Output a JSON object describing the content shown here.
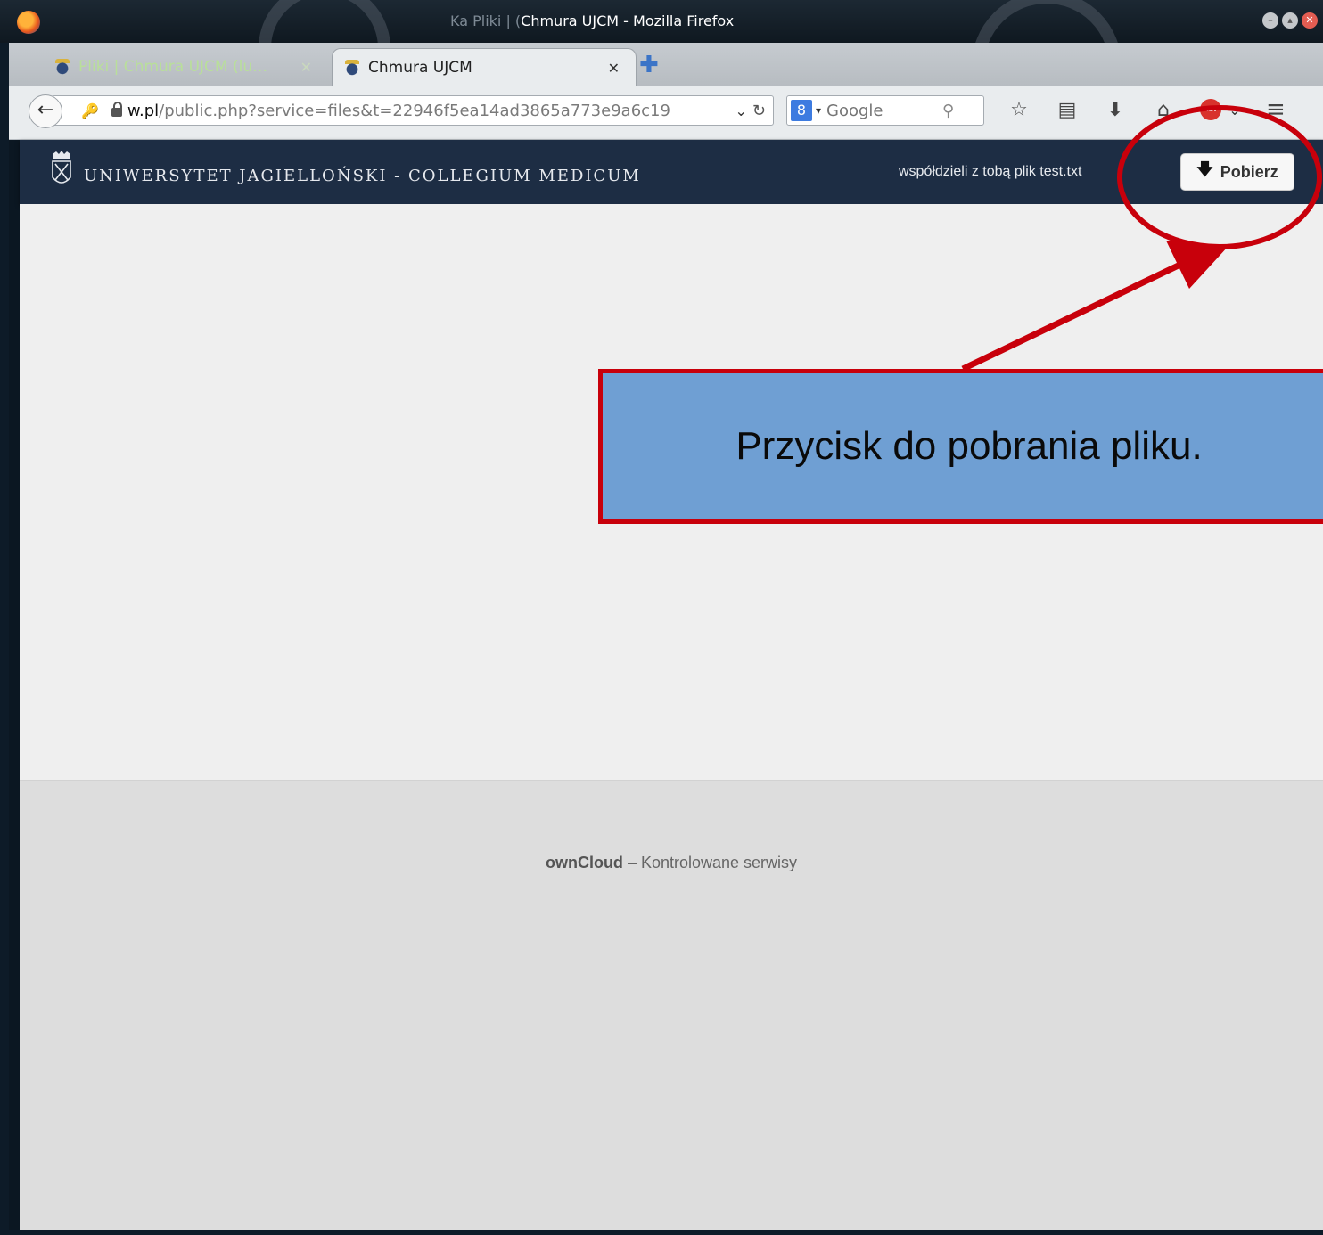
{
  "window": {
    "title_prefix": "Ka Pliki | (",
    "title": "Chmura UJCM - Mozilla Firefox",
    "minimize_label": "–",
    "maximize_label": "▴",
    "close_label": "✕"
  },
  "tabs": [
    {
      "label": "Pliki | Chmura UJCM (lu…",
      "close": "✕"
    },
    {
      "label": "Chmura UJCM",
      "close": "✕"
    }
  ],
  "newtab_label": "✚",
  "navbar": {
    "back": "←",
    "url_domain": "w.pl",
    "url_path": "/public.php?service=files&t=22946f5ea14ad3865a773e9a6c19",
    "url_drop": "⌄",
    "reload": "↻",
    "search_engine": "8",
    "search_drop": "▾",
    "search_placeholder": "Google",
    "search_mag": "🔍",
    "icons": {
      "bookmark": "☆",
      "reading_list": "▤",
      "downloads": "⬇",
      "home": "⌂",
      "abp": "ABP",
      "abp_drop": "⌄",
      "menu": "≡"
    }
  },
  "header": {
    "logo_text": "UNIWERSYTET JAGIELLOŃSKI - COLLEGIUM MEDICUM",
    "share_text": "współdzieli z tobą plik test.txt",
    "download_arrow": "🡇",
    "download_label": "Pobierz"
  },
  "footer": {
    "brand": "ownCloud",
    "tagline": " – Kontrolowane serwisy"
  },
  "annotation": {
    "text": "Przycisk do pobrania pliku.",
    "color": "#c8000b",
    "box_color": "#6f9fd3"
  },
  "colors": {
    "header_bg": "#1d2d44",
    "content_bg": "#efefef",
    "footer_bg": "#dddddd"
  }
}
